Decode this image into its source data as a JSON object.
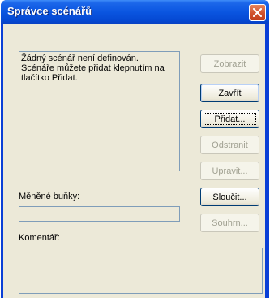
{
  "dialog": {
    "title": "Správce scénářů",
    "list_message": "Žádný scénář není definován.\nScénáře můžete přidat klepnutím na\ntlačítko Přidat.",
    "changing_cells_label": "Měněné buňky:",
    "changing_cells_value": "",
    "comment_label": "Komentář:",
    "comment_value": ""
  },
  "buttons": {
    "show": "Zobrazit",
    "close": "Zavřít",
    "add": "Přidat...",
    "delete": "Odstranit",
    "edit": "Upravit...",
    "merge": "Sloučit...",
    "summary": "Souhrn..."
  },
  "icons": {
    "close": "close-icon"
  }
}
